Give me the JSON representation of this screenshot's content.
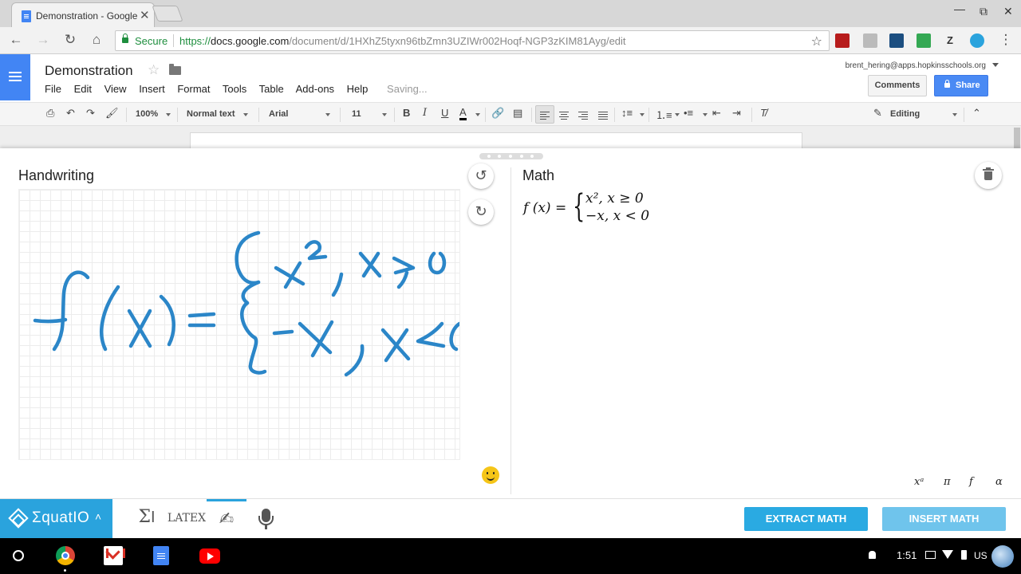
{
  "browser": {
    "tab_title": "Demonstration - Google",
    "tab_close": "✕",
    "secure_label": "Secure",
    "url_scheme": "https://",
    "url_host": "docs.google.com",
    "url_path": "/document/d/1HXhZ5tyxn96tbZmn3UZIWr002Hoqf-NGP3zKIM81Ayg/edit",
    "extension_z": "Z"
  },
  "docs": {
    "title": "Demonstration",
    "menu": [
      "File",
      "Edit",
      "View",
      "Insert",
      "Format",
      "Tools",
      "Table",
      "Add-ons",
      "Help"
    ],
    "saving": "Saving...",
    "account": "brent_hering@apps.hopkinsschools.org",
    "comments_label": "Comments",
    "share_label": "Share",
    "toolbar": {
      "zoom": "100%",
      "style": "Normal text",
      "font": "Arial",
      "size": "11",
      "bold": "B",
      "italic": "I",
      "underline": "U",
      "text_color": "A",
      "mode": "Editing"
    }
  },
  "equatio": {
    "handwriting_title": "Handwriting",
    "math_title": "Math",
    "ink_color": "#2b86c8",
    "math_lhs": "f (x) =",
    "math_case_1": "x², x ≥ 0",
    "math_case_2": "−x, x < 0",
    "symbols": [
      "xᵃ",
      "π",
      "f",
      "α"
    ],
    "brand": "ΣquatIO",
    "brand_tm": "˜",
    "tools": {
      "sigma": "Σ",
      "latex": "LATEX"
    },
    "extract_label": "EXTRACT MATH",
    "insert_label": "INSERT MATH"
  },
  "shelf": {
    "time": "1:51",
    "locale": "US"
  }
}
